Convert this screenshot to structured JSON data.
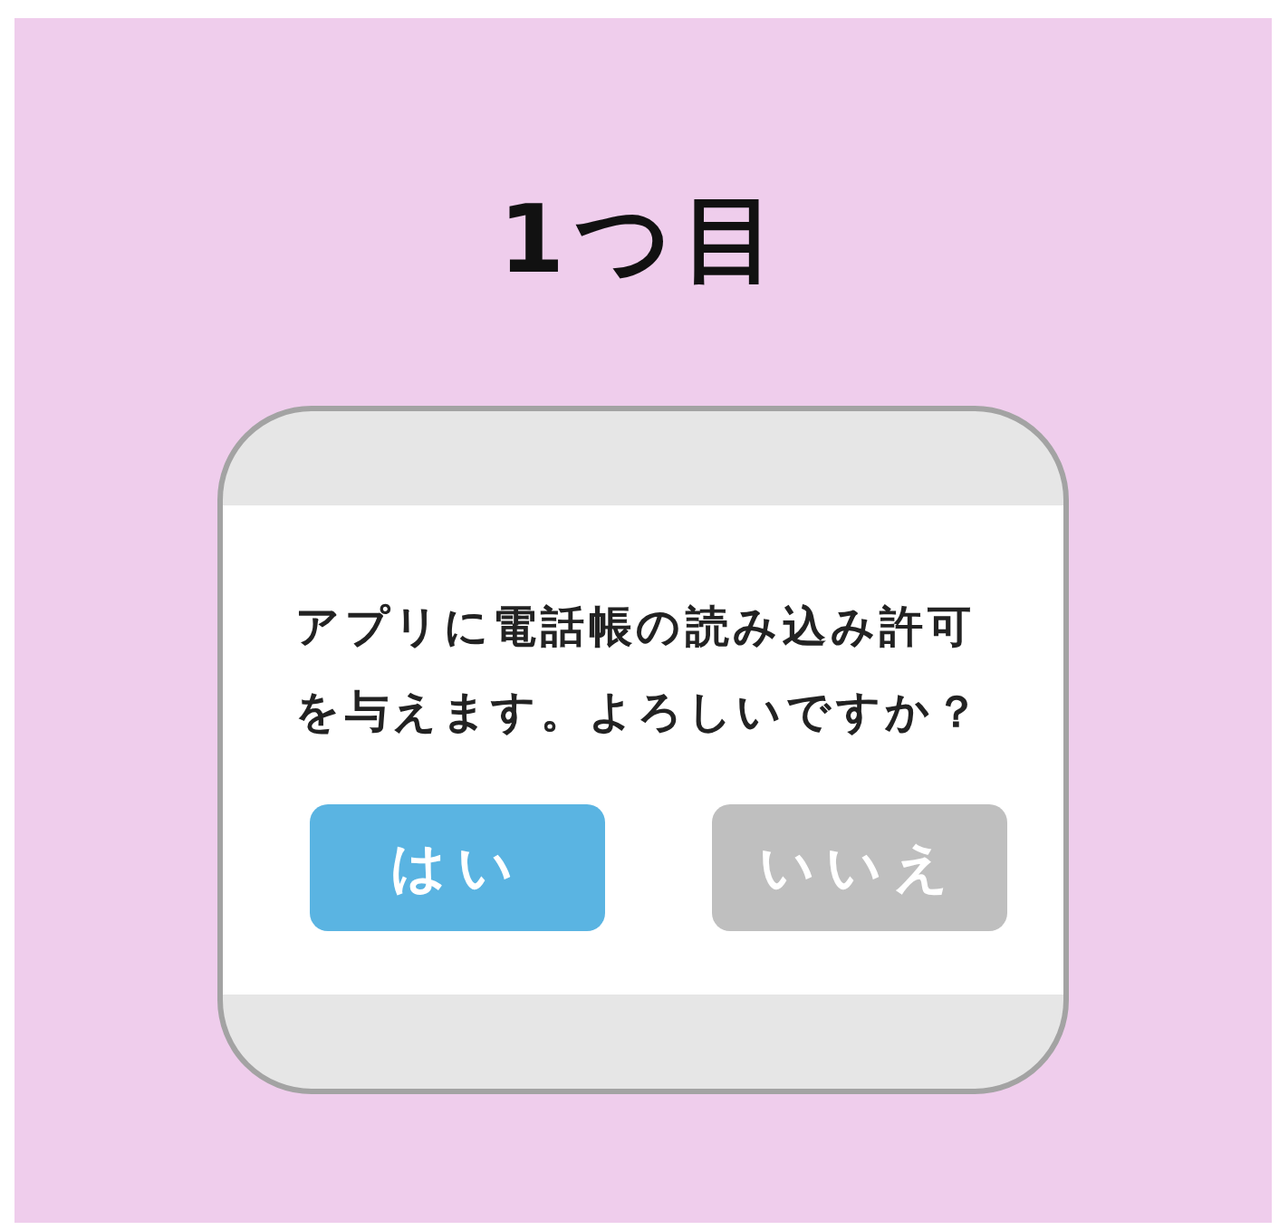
{
  "title": "1つ目",
  "dialog": {
    "message": "アプリに電話帳の読み込み許可を与えます。よろしいですか？",
    "buttons": [
      {
        "label": "はい",
        "kind": "primary"
      },
      {
        "label": "いいえ",
        "kind": "secondary"
      }
    ]
  }
}
